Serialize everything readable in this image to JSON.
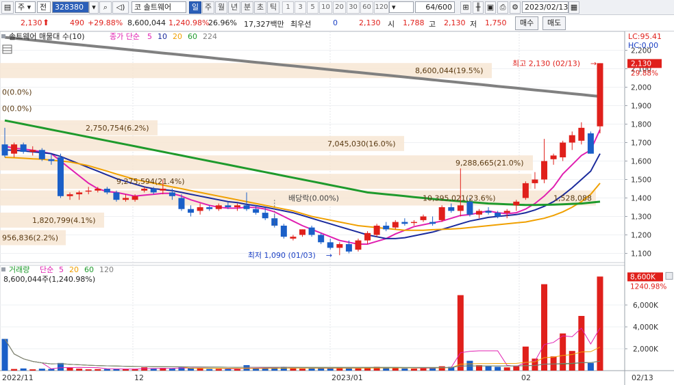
{
  "toolbar": {
    "market": "주",
    "prev": "전",
    "code": "328380",
    "stock_prefix": "코",
    "stock_name": "솔트웨어",
    "periods": [
      "일",
      "주",
      "월",
      "년",
      "분",
      "초",
      "틱"
    ],
    "active_period": "일",
    "intervals": [
      "1",
      "3",
      "5",
      "10",
      "20",
      "30",
      "60",
      "120"
    ],
    "count": "64/600",
    "date": "2023/02/13"
  },
  "quote": {
    "price": "2,130",
    "change": "490",
    "change_pct": "+29.88%",
    "volume": "8,600,044",
    "volume_ratio": "1,240.98%",
    "turnover": "26.96%",
    "amount": "17,327백만",
    "best_label": "최우선",
    "best_value": "0",
    "best_price": "2,130",
    "open_label": "시",
    "open": "1,788",
    "high_label": "고",
    "high": "2,130",
    "low_label": "저",
    "low": "1,750",
    "buy_label": "매수",
    "sell_label": "매도"
  },
  "price_panel": {
    "legend_name": "솔트웨어 매물대 수(10)",
    "ma_label": "종가 단순",
    "ma_periods": [
      "5",
      "10",
      "20",
      "60",
      "224"
    ],
    "ma_colors": [
      "#e01fb0",
      "#1a2a9c",
      "#f0a000",
      "#1e9a2c",
      "#808080"
    ],
    "lc": "LC:95.41",
    "hc": "HC:0.00",
    "last_price_tag": "2,130",
    "last_pct_tag": "29.88%",
    "high_note": "최고 2,130 (02/13)",
    "low_note": "최저 1,090 (01/03)",
    "dividend_note": "배당락(0.00%)",
    "y_ticks": [
      "2,200",
      "2,100",
      "2,000",
      "1,900",
      "1,800",
      "1,700",
      "1,600",
      "1,500",
      "1,400",
      "1,300",
      "1,200",
      "1,100"
    ],
    "profile": [
      {
        "label": "8,600,044(19.5%)"
      },
      {
        "label": "0(0.0%)"
      },
      {
        "label": "0(0.0%)"
      },
      {
        "label": "2,750,754(6.2%)"
      },
      {
        "label": "7,045,030(16.0%)"
      },
      {
        "label": "9,288,665(21.0%)"
      },
      {
        "label": "9,275,594(21.4%)"
      },
      {
        "label": "10,395,021(23.6%)"
      },
      {
        "label": "1,820,799(4.1%)"
      },
      {
        "label": "1,528,088"
      },
      {
        "label": "956,836(2.2%)"
      }
    ]
  },
  "volume_panel": {
    "legend_name": "거래량",
    "ma_label": "단순",
    "ma_periods": [
      "5",
      "20",
      "60",
      "120"
    ],
    "ma_colors": [
      "#e01fb0",
      "#f0a000",
      "#1e9a2c",
      "#808080"
    ],
    "value_line": "8,600,044주(1,240.98%)",
    "last_tag": "8,600K",
    "last_pct": "1240.98%",
    "y_ticks": [
      "6,000K",
      "4,000K",
      "2,000K"
    ]
  },
  "x_axis": [
    "2022/11",
    "12",
    "2023/01",
    "02",
    "02/13"
  ],
  "colors": {
    "up": "#e0201b",
    "down": "#1a5fc8",
    "accent": "#2b5fb8"
  },
  "chart_data": {
    "type": "candlestick",
    "ylim": [
      1050,
      2250
    ],
    "volume_ylim": [
      0,
      9000000
    ],
    "ohlc": [
      [
        1690,
        1780,
        1620,
        1630
      ],
      [
        1640,
        1700,
        1620,
        1690
      ],
      [
        1690,
        1700,
        1640,
        1650
      ],
      [
        1650,
        1680,
        1630,
        1660
      ],
      [
        1660,
        1670,
        1600,
        1610
      ],
      [
        1610,
        1640,
        1580,
        1600
      ],
      [
        1620,
        1640,
        1400,
        1410
      ],
      [
        1410,
        1430,
        1390,
        1420
      ],
      [
        1420,
        1440,
        1390,
        1430
      ],
      [
        1440,
        1460,
        1420,
        1440
      ],
      [
        1440,
        1460,
        1430,
        1450
      ],
      [
        1450,
        1460,
        1420,
        1430
      ],
      [
        1430,
        1440,
        1380,
        1390
      ],
      [
        1390,
        1420,
        1380,
        1400
      ],
      [
        1390,
        1420,
        1380,
        1410
      ],
      [
        1440,
        1460,
        1430,
        1450
      ],
      [
        1450,
        1460,
        1420,
        1430
      ],
      [
        1440,
        1500,
        1420,
        1450
      ],
      [
        1430,
        1450,
        1390,
        1410
      ],
      [
        1400,
        1420,
        1330,
        1340
      ],
      [
        1340,
        1360,
        1300,
        1320
      ],
      [
        1330,
        1370,
        1310,
        1350
      ],
      [
        1350,
        1360,
        1330,
        1340
      ],
      [
        1340,
        1370,
        1330,
        1360
      ],
      [
        1360,
        1380,
        1340,
        1350
      ],
      [
        1350,
        1370,
        1330,
        1360
      ],
      [
        1360,
        1430,
        1330,
        1340
      ],
      [
        1340,
        1360,
        1310,
        1320
      ],
      [
        1320,
        1350,
        1280,
        1290
      ],
      [
        1290,
        1310,
        1240,
        1250
      ],
      [
        1250,
        1260,
        1180,
        1190
      ],
      [
        1180,
        1200,
        1170,
        1190
      ],
      [
        1200,
        1230,
        1190,
        1230
      ],
      [
        1240,
        1250,
        1190,
        1200
      ],
      [
        1200,
        1210,
        1150,
        1160
      ],
      [
        1160,
        1180,
        1120,
        1130
      ],
      [
        1130,
        1160,
        1090,
        1150
      ],
      [
        1150,
        1170,
        1100,
        1110
      ],
      [
        1120,
        1180,
        1110,
        1170
      ],
      [
        1170,
        1220,
        1150,
        1210
      ],
      [
        1200,
        1260,
        1190,
        1250
      ],
      [
        1250,
        1270,
        1220,
        1230
      ],
      [
        1240,
        1280,
        1230,
        1270
      ],
      [
        1270,
        1290,
        1250,
        1260
      ],
      [
        1270,
        1280,
        1250,
        1270
      ],
      [
        1280,
        1310,
        1270,
        1300
      ],
      [
        1270,
        1300,
        1250,
        1260
      ],
      [
        1280,
        1360,
        1270,
        1350
      ],
      [
        1350,
        1370,
        1320,
        1330
      ],
      [
        1330,
        1560,
        1300,
        1360
      ],
      [
        1380,
        1400,
        1300,
        1310
      ],
      [
        1310,
        1340,
        1290,
        1330
      ],
      [
        1330,
        1350,
        1310,
        1320
      ],
      [
        1320,
        1330,
        1290,
        1300
      ],
      [
        1320,
        1340,
        1290,
        1330
      ],
      [
        1360,
        1390,
        1330,
        1380
      ],
      [
        1400,
        1490,
        1390,
        1480
      ],
      [
        1480,
        1540,
        1450,
        1500
      ],
      [
        1500,
        1720,
        1480,
        1600
      ],
      [
        1610,
        1640,
        1580,
        1630
      ],
      [
        1620,
        1710,
        1600,
        1700
      ],
      [
        1700,
        1760,
        1660,
        1740
      ],
      [
        1710,
        1810,
        1690,
        1780
      ],
      [
        1750,
        1760,
        1640,
        1640
      ],
      [
        1788,
        2130,
        1750,
        2130
      ]
    ],
    "volume": [
      2900000,
      150000,
      200000,
      120000,
      180000,
      160000,
      700000,
      250000,
      180000,
      120000,
      140000,
      150000,
      180000,
      160000,
      120000,
      300000,
      200000,
      250000,
      180000,
      300000,
      280000,
      200000,
      150000,
      160000,
      150000,
      140000,
      500000,
      200000,
      250000,
      300000,
      350000,
      200000,
      180000,
      200000,
      250000,
      250000,
      300000,
      200000,
      200000,
      300000,
      350000,
      250000,
      250000,
      200000,
      180000,
      300000,
      250000,
      400000,
      350000,
      6900000,
      900000,
      500000,
      400000,
      350000,
      300000,
      400000,
      2200000,
      1100000,
      7900000,
      1300000,
      3400000,
      1800000,
      5000000,
      700000,
      8600000
    ],
    "ma5": [
      1680,
      1670,
      1665,
      1658,
      1650,
      1640,
      1600,
      1560,
      1520,
      1480,
      1450,
      1435,
      1430,
      1420,
      1410,
      1415,
      1420,
      1425,
      1425,
      1410,
      1390,
      1375,
      1360,
      1350,
      1345,
      1345,
      1350,
      1348,
      1340,
      1325,
      1300,
      1275,
      1250,
      1230,
      1210,
      1190,
      1170,
      1160,
      1150,
      1150,
      1165,
      1180,
      1205,
      1225,
      1245,
      1255,
      1265,
      1275,
      1290,
      1305,
      1310,
      1320,
      1330,
      1320,
      1315,
      1320,
      1340,
      1370,
      1410,
      1460,
      1530,
      1580,
      1630,
      1660,
      1770
    ],
    "ma10": [
      1660,
      1658,
      1655,
      1650,
      1645,
      1640,
      1625,
      1605,
      1585,
      1565,
      1545,
      1525,
      1505,
      1490,
      1475,
      1460,
      1450,
      1445,
      1440,
      1430,
      1420,
      1410,
      1400,
      1390,
      1380,
      1375,
      1365,
      1358,
      1350,
      1340,
      1330,
      1320,
      1305,
      1290,
      1275,
      1260,
      1245,
      1230,
      1215,
      1200,
      1190,
      1180,
      1180,
      1185,
      1195,
      1205,
      1215,
      1230,
      1245,
      1260,
      1275,
      1285,
      1295,
      1300,
      1305,
      1310,
      1320,
      1335,
      1355,
      1380,
      1415,
      1455,
      1500,
      1545,
      1640
    ],
    "ma20": [
      1620,
      1618,
      1615,
      1612,
      1610,
      1605,
      1600,
      1595,
      1585,
      1575,
      1560,
      1545,
      1530,
      1515,
      1500,
      1490,
      1480,
      1470,
      1460,
      1450,
      1440,
      1430,
      1420,
      1410,
      1400,
      1390,
      1380,
      1370,
      1360,
      1350,
      1340,
      1330,
      1315,
      1300,
      1290,
      1280,
      1270,
      1260,
      1250,
      1245,
      1240,
      1235,
      1230,
      1225,
      1225,
      1225,
      1228,
      1230,
      1232,
      1235,
      1240,
      1245,
      1250,
      1255,
      1260,
      1265,
      1270,
      1280,
      1290,
      1305,
      1325,
      1350,
      1380,
      1420,
      1480
    ],
    "ma60": [
      1820,
      1810,
      1800,
      1790,
      1780,
      1770,
      1760,
      1750,
      1740,
      1730,
      1720,
      1710,
      1700,
      1690,
      1680,
      1670,
      1660,
      1650,
      1640,
      1630,
      1620,
      1610,
      1600,
      1590,
      1580,
      1570,
      1560,
      1550,
      1540,
      1530,
      1520,
      1510,
      1500,
      1490,
      1480,
      1470,
      1460,
      1450,
      1440,
      1430,
      1425,
      1420,
      1415,
      1410,
      1405,
      1400,
      1395,
      1390,
      1386,
      1382,
      1378,
      1374,
      1370,
      1368,
      1366,
      1364,
      1362,
      1362,
      1363,
      1364,
      1366,
      1368,
      1370,
      1375,
      1380
    ],
    "ma224": [
      2270,
      2265,
      2260,
      2255,
      2250,
      2245,
      2240,
      2235,
      2230,
      2225,
      2220,
      2215,
      2210,
      2205,
      2200,
      2195,
      2190,
      2185,
      2180,
      2175,
      2170,
      2165,
      2160,
      2155,
      2150,
      2145,
      2140,
      2135,
      2130,
      2125,
      2120,
      2115,
      2110,
      2105,
      2100,
      2095,
      2090,
      2085,
      2080,
      2075,
      2070,
      2065,
      2060,
      2055,
      2050,
      2045,
      2040,
      2035,
      2030,
      2025,
      2020,
      2015,
      2010,
      2005,
      2000,
      1995,
      1990,
      1985,
      1980,
      1975,
      1970,
      1965,
      1960,
      1955,
      1950
    ],
    "profile_values": [
      8600044,
      0,
      0,
      2750754,
      7045030,
      9288665,
      9275594,
      10395021,
      1820799,
      1528088,
      956836
    ]
  }
}
